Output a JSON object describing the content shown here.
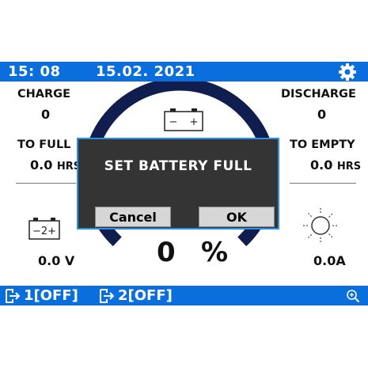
{
  "status_bar": {
    "time": "15: 08",
    "date": "15.02. 2021",
    "settings_icon": "gear-icon"
  },
  "colors": {
    "bar_blue": "#0a6fdc",
    "gauge_navy": "#0f1d4f",
    "dialog_bg": "#343434",
    "dialog_border": "#2a90e6"
  },
  "charge": {
    "label": "CHARGE",
    "value": "0"
  },
  "discharge": {
    "label": "DISCHARGE",
    "value": "0"
  },
  "to_full": {
    "label": "TO FULL",
    "value": "0.0",
    "unit": "HRS"
  },
  "to_empty": {
    "label": "TO EMPTY",
    "value": "0.0",
    "unit": "HRS"
  },
  "battery_top": {
    "icon": "battery-icon",
    "minus": "−",
    "plus": "+"
  },
  "battery_voltage": {
    "icon": "battery-icon",
    "glyph": "−2+",
    "value": "0.0 V"
  },
  "current": {
    "icon": "sun-icon",
    "value": "0.0A"
  },
  "state_of_charge": {
    "value": "0",
    "unit": "%",
    "level_percent": 0
  },
  "dialog": {
    "message": "SET BATTERY FULL",
    "cancel_label": "Cancel",
    "ok_label": "OK"
  },
  "outputs": [
    {
      "label": "1[OFF]",
      "icon": "output-arrow-icon"
    },
    {
      "label": "2[OFF]",
      "icon": "output-arrow-icon"
    }
  ],
  "zoom_icon": "zoom-in-icon"
}
